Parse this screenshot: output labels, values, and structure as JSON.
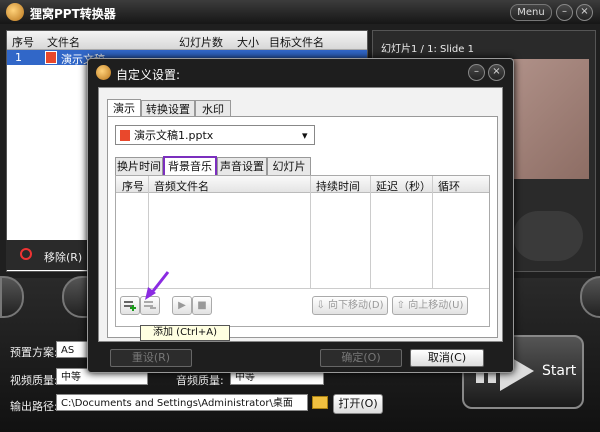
{
  "app": {
    "title": "狸窝PPT转换器",
    "menu_label": "Menu",
    "minimize": "–",
    "close": "×"
  },
  "file_list": {
    "headers": [
      "序号",
      "文件名",
      "幻灯片数",
      "大小",
      "目标文件名"
    ],
    "rows": [
      {
        "index": "1",
        "name": "演示文稿"
      }
    ]
  },
  "remove_label": "移除(R)",
  "preview": {
    "label": "幻灯片1 / 1: Slide 1"
  },
  "bottom": {
    "preset_label": "预置方案:",
    "preset_value": "AS",
    "video_quality_label": "视频质量:",
    "video_quality_value": "中等",
    "audio_quality_label": "音频质量:",
    "audio_quality_value": "中等",
    "output_label": "输出路径:",
    "output_value": "C:\\Documents and Settings\\Administrator\\桌面",
    "open_button": "打开(O)",
    "start_button": "Start"
  },
  "dialog": {
    "title": "自定义设置:",
    "tabs": [
      "演示",
      "转换设置",
      "水印"
    ],
    "file_select": "演示文稿1.pptx",
    "subtabs": [
      "换片时间",
      "背景音乐",
      "声音设置",
      "幻灯片"
    ],
    "audio_headers": [
      "序号",
      "音频文件名",
      "持续时间",
      "延迟（秒）",
      "循环"
    ],
    "move_down": "向下移动(D)",
    "move_up": "向上移动(U)",
    "tooltip": "添加 (Ctrl+A)",
    "reset_button": "重设(R)",
    "ok_button": "确定(O)",
    "cancel_button": "取消(C)"
  },
  "colors": {
    "selection": "#3167c8",
    "highlight_border": "#7b2fbe",
    "arrow": "#8b2be2"
  }
}
